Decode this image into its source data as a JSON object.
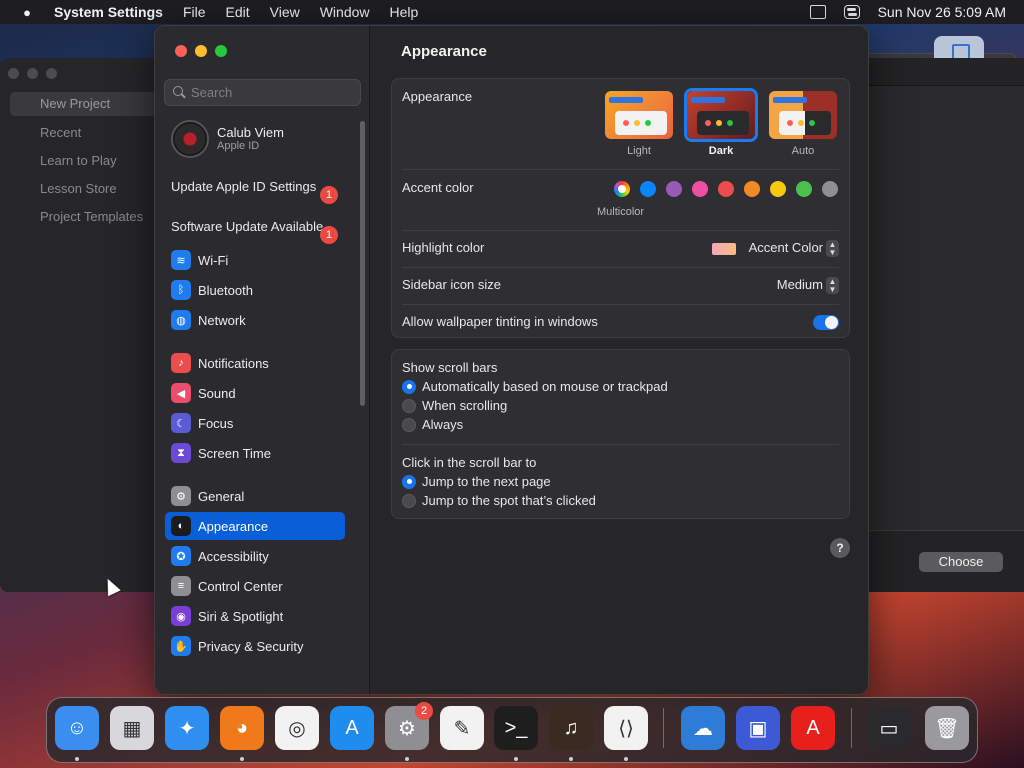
{
  "menubar": {
    "app_name": "System Settings",
    "menus": [
      "File",
      "Edit",
      "View",
      "Window",
      "Help"
    ],
    "clock": "Sun Nov 26  5:09 AM"
  },
  "background_window": {
    "items": [
      "New Project",
      "Recent",
      "Learn to Play",
      "Lesson Store",
      "Project Templates"
    ],
    "choose_label": "Choose"
  },
  "sidebar": {
    "search_placeholder": "Search",
    "account": {
      "name": "Calub Viem",
      "subtitle": "Apple ID"
    },
    "notices": [
      {
        "label": "Update Apple ID Settings",
        "badge": "1"
      },
      {
        "label": "Software Update Available",
        "badge": "1"
      }
    ],
    "items": [
      {
        "label": "Wi-Fi",
        "icon": "wifi-icon",
        "color": "#1f7cf0"
      },
      {
        "label": "Bluetooth",
        "icon": "bluetooth-icon",
        "color": "#1f7cf0"
      },
      {
        "label": "Network",
        "icon": "globe-icon",
        "color": "#1f7cf0"
      },
      {
        "label": "Notifications",
        "icon": "bell-icon",
        "color": "#eb4d4d"
      },
      {
        "label": "Sound",
        "icon": "speaker-icon",
        "color": "#eb4d6a"
      },
      {
        "label": "Focus",
        "icon": "moon-icon",
        "color": "#5b5bd6"
      },
      {
        "label": "Screen Time",
        "icon": "hourglass-icon",
        "color": "#6a4ad6"
      },
      {
        "label": "General",
        "icon": "gear-icon",
        "color": "#8e8e93"
      },
      {
        "label": "Appearance",
        "icon": "appearance-icon",
        "color": "#1c1c1e"
      },
      {
        "label": "Accessibility",
        "icon": "accessibility-icon",
        "color": "#1f7cf0"
      },
      {
        "label": "Control Center",
        "icon": "switches-icon",
        "color": "#8e8e93"
      },
      {
        "label": "Siri & Spotlight",
        "icon": "siri-icon",
        "color": "#7a3fd6"
      },
      {
        "label": "Privacy & Security",
        "icon": "hand-icon",
        "color": "#1f7cf0"
      }
    ],
    "selected": "Appearance"
  },
  "main": {
    "title": "Appearance",
    "appearance": {
      "label": "Appearance",
      "options": [
        "Light",
        "Dark",
        "Auto"
      ],
      "selected": "Dark"
    },
    "accent": {
      "label": "Accent color",
      "caption": "Multicolor",
      "colors": [
        "#0a84ff",
        "#9b59b6",
        "#ec4fa3",
        "#eb4d4d",
        "#f08a24",
        "#f6c90e",
        "#4cbf4c",
        "#8e8e93"
      ]
    },
    "highlight": {
      "label": "Highlight color",
      "value": "Accent Color"
    },
    "sidebar_icon_size": {
      "label": "Sidebar icon size",
      "value": "Medium"
    },
    "wallpaper_tinting": {
      "label": "Allow wallpaper tinting in windows",
      "enabled": true
    },
    "scroll_bars": {
      "heading": "Show scroll bars",
      "options": [
        "Automatically based on mouse or trackpad",
        "When scrolling",
        "Always"
      ],
      "selected": 0
    },
    "click_scroll": {
      "heading": "Click in the scroll bar to",
      "options": [
        "Jump to the next page",
        "Jump to the spot that’s clicked"
      ],
      "selected": 0
    },
    "help_label": "?"
  },
  "dock": {
    "apps": [
      {
        "name": "Finder",
        "icon": "finder-icon",
        "color": "#3a8ef0",
        "running": true
      },
      {
        "name": "Launchpad",
        "icon": "launchpad-icon",
        "color": "#d8d8dc",
        "running": false
      },
      {
        "name": "Safari",
        "icon": "safari-icon",
        "color": "#2f8ff0",
        "running": false
      },
      {
        "name": "Firefox",
        "icon": "firefox-icon",
        "color": "#f07a1a",
        "running": true
      },
      {
        "name": "Chrome",
        "icon": "chrome-icon",
        "color": "#f2f2f2",
        "running": false
      },
      {
        "name": "App Store",
        "icon": "appstore-icon",
        "color": "#1f8cf0",
        "running": false
      },
      {
        "name": "System Settings",
        "icon": "settings-icon",
        "color": "#8e8e93",
        "running": true,
        "badge": "2"
      },
      {
        "name": "TextEdit",
        "icon": "textedit-icon",
        "color": "#f2f2f2",
        "running": false
      },
      {
        "name": "Terminal",
        "icon": "terminal-icon",
        "color": "#1e1e1e",
        "running": true
      },
      {
        "name": "GarageBand",
        "icon": "guitar-icon",
        "color": "#3a2a20",
        "running": true
      },
      {
        "name": "VS Code",
        "icon": "vscode-icon",
        "color": "#f2f2f2",
        "running": true
      },
      {
        "name": "Weather",
        "icon": "weather-icon",
        "color": "#2f7cd6",
        "running": false
      },
      {
        "name": "Screens",
        "icon": "screens-icon",
        "color": "#3c5ad6",
        "running": false
      },
      {
        "name": "Adobe",
        "icon": "adobe-icon",
        "color": "#e8201c",
        "running": false
      },
      {
        "name": "Recent Window",
        "icon": "window-thumbnail-icon",
        "color": "#2a2a2c",
        "running": false
      },
      {
        "name": "Trash",
        "icon": "trash-icon",
        "color": "#9a9a9e",
        "running": false
      }
    ]
  }
}
